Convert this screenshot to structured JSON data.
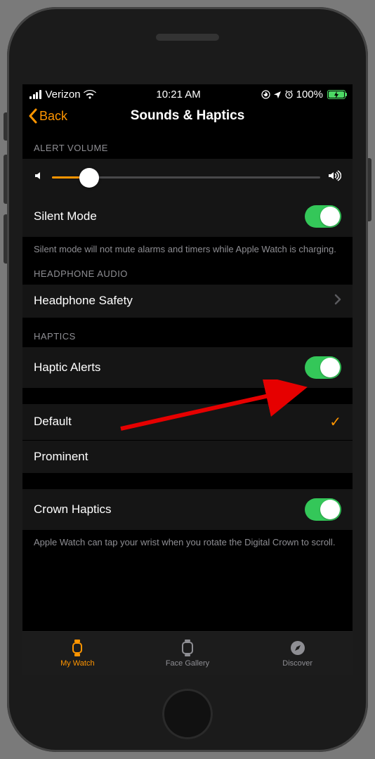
{
  "status": {
    "carrier": "Verizon",
    "time": "10:21 AM",
    "battery_pct": "100%"
  },
  "nav": {
    "back_label": "Back",
    "title": "Sounds & Haptics"
  },
  "sections": {
    "alert_volume_header": "ALERT VOLUME",
    "silent_mode_label": "Silent Mode",
    "silent_mode_note": "Silent mode will not mute alarms and timers while Apple Watch is charging.",
    "headphone_header": "HEADPHONE AUDIO",
    "headphone_safety_label": "Headphone Safety",
    "haptics_header": "HAPTICS",
    "haptic_alerts_label": "Haptic Alerts",
    "default_label": "Default",
    "prominent_label": "Prominent",
    "crown_haptics_label": "Crown Haptics",
    "crown_note": "Apple Watch can tap your wrist when you rotate the Digital Crown to scroll."
  },
  "tabs": {
    "my_watch": "My Watch",
    "face_gallery": "Face Gallery",
    "discover": "Discover"
  }
}
